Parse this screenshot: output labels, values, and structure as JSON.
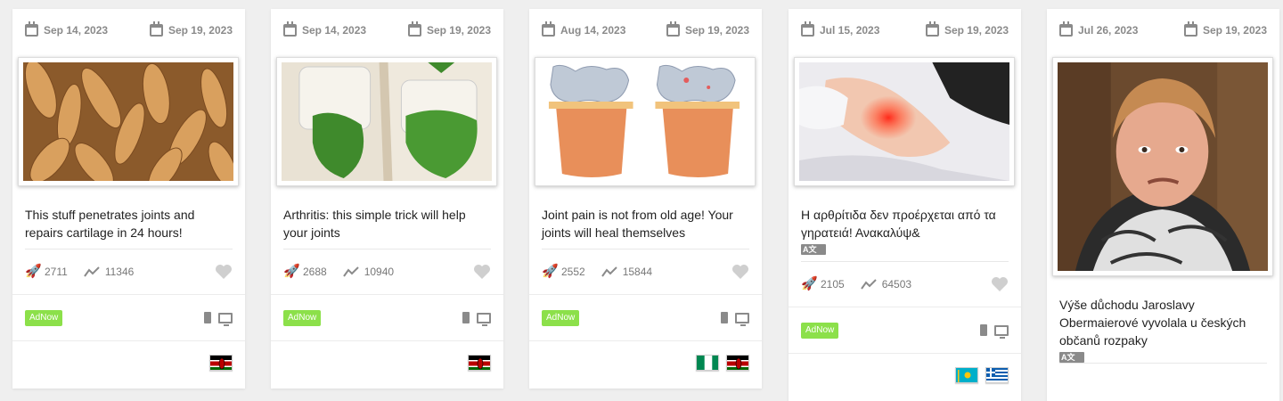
{
  "colors": {
    "accent": "#8ce04a",
    "muted": "#8a8a8a"
  },
  "cards": [
    {
      "date_start": "Sep 14, 2023",
      "date_end": "Sep 19, 2023",
      "title": "This stuff penetrates joints and repairs cartilage in 24 hours!",
      "launches": "2711",
      "trend": "11346",
      "badge": "AdNow",
      "flags": [
        "kenya"
      ]
    },
    {
      "date_start": "Sep 14, 2023",
      "date_end": "Sep 19, 2023",
      "title": "Arthritis: this simple trick will help your joints",
      "launches": "2688",
      "trend": "10940",
      "badge": "AdNow",
      "flags": [
        "kenya"
      ]
    },
    {
      "date_start": "Aug 14, 2023",
      "date_end": "Sep 19, 2023",
      "title": "Joint pain is not from old age! Your joints will heal themselves",
      "launches": "2552",
      "trend": "15844",
      "badge": "AdNow",
      "flags": [
        "nigeria",
        "kenya"
      ]
    },
    {
      "date_start": "Jul 15, 2023",
      "date_end": "Sep 19, 2023",
      "title": "Η αρθρίτιδα δεν προέρχεται από τα γηρατειά! Ανακαλύψ&",
      "translate_label": "A文",
      "launches": "2105",
      "trend": "64503",
      "badge": "AdNow",
      "flags": [
        "kazakhstan",
        "greece"
      ]
    },
    {
      "date_start": "Jul 26, 2023",
      "date_end": "Sep 19, 2023",
      "title": "Výše důchodu Jaroslavy Obermaierové vyvolala u českých občanů rozpaky",
      "translate_label": "A文"
    }
  ]
}
